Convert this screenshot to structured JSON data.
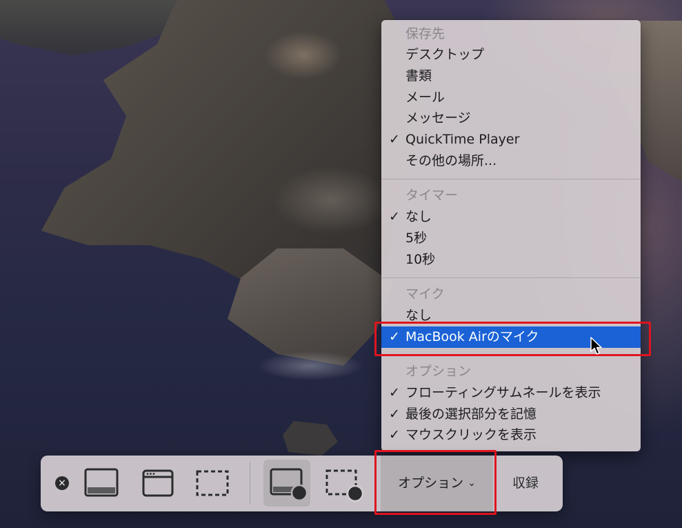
{
  "menu": {
    "save_to": {
      "header": "保存先",
      "items": [
        {
          "label": "デスクトップ",
          "checked": false
        },
        {
          "label": "書類",
          "checked": false
        },
        {
          "label": "メール",
          "checked": false
        },
        {
          "label": "メッセージ",
          "checked": false
        },
        {
          "label": "QuickTime Player",
          "checked": true
        },
        {
          "label": "その他の場所...",
          "checked": false
        }
      ]
    },
    "timer": {
      "header": "タイマー",
      "items": [
        {
          "label": "なし",
          "checked": true
        },
        {
          "label": "5秒",
          "checked": false
        },
        {
          "label": "10秒",
          "checked": false
        }
      ]
    },
    "microphone": {
      "header": "マイク",
      "items": [
        {
          "label": "なし",
          "checked": false
        },
        {
          "label": "MacBook Airのマイク",
          "checked": true,
          "highlighted": true
        }
      ]
    },
    "options": {
      "header": "オプション",
      "items": [
        {
          "label": "フローティングサムネールを表示",
          "checked": true
        },
        {
          "label": "最後の選択部分を記憶",
          "checked": true
        },
        {
          "label": "マウスクリックを表示",
          "checked": true
        }
      ]
    },
    "check_mark": "✓"
  },
  "toolbar": {
    "close_icon": "×",
    "options_label": "オプション",
    "options_chevron": "⌄",
    "record_label": "収録",
    "selected_mode": "record-entire-screen"
  },
  "colors": {
    "selection": "#1a62d6",
    "annotation_box": "#e0141f"
  }
}
